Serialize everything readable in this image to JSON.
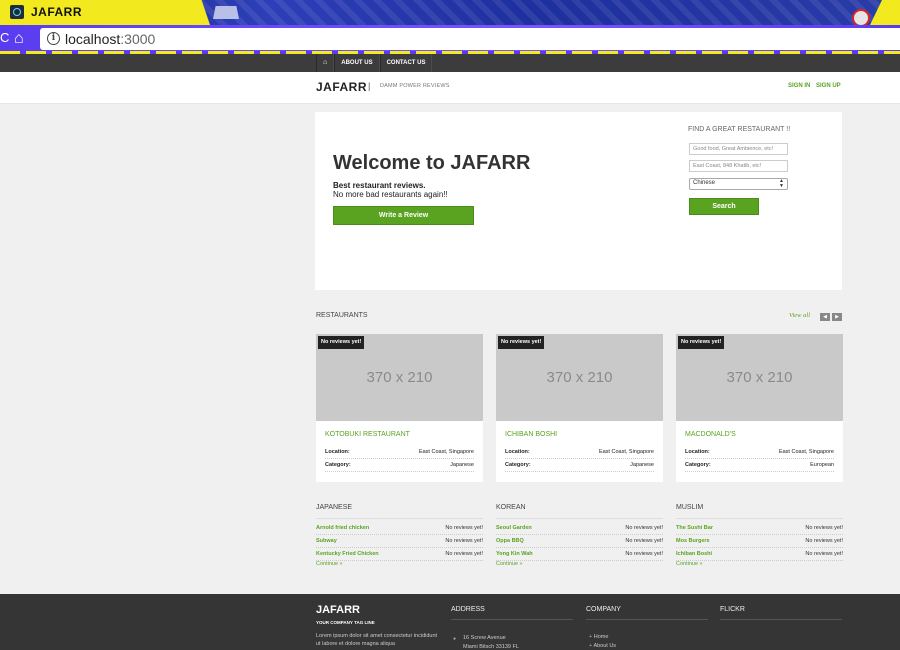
{
  "browser": {
    "tab_title": "JAFARR",
    "url_host": "localhost",
    "url_port": ":3000",
    "nav_partial": "C"
  },
  "topnav": {
    "home_icon": "home-icon",
    "items": [
      "ABOUT US",
      "CONTACT US"
    ]
  },
  "header": {
    "logo": "JAFARR",
    "separator": "|",
    "tagline": "DAMM POWER REVIEWS",
    "sign_in": "SIGN IN",
    "sign_up": "SIGN UP"
  },
  "hero": {
    "title": "Welcome to JAFARR",
    "subtitle_bold": "Best restaurant reviews.",
    "subtitle": "No more bad restaurants again!!",
    "write_button": "Write a Review",
    "find_title": "FIND A GREAT RESTAURANT !!",
    "field1_placeholder": "Good food, Great Ambience, etc!",
    "field2_placeholder": "East Coast, 848 Khatib, etc!",
    "cuisine_selected": "Chinese",
    "search_button": "Search"
  },
  "restaurants": {
    "section_title": "RESTAURANTS",
    "view_all": "View all",
    "prev": "◀",
    "next": "▶",
    "cards": [
      {
        "badge": "No reviews yet!",
        "image_text": "370 x 210",
        "name": "KOTOBUKI RESTAURANT",
        "location_label": "Location:",
        "location": "East Coast, Singapore",
        "category_label": "Category:",
        "category": "Japanese"
      },
      {
        "badge": "No reviews yet!",
        "image_text": "370 x 210",
        "name": "ICHIBAN BOSHI",
        "location_label": "Location:",
        "location": "East Coast, Singapore",
        "category_label": "Category:",
        "category": "Japanese"
      },
      {
        "badge": "No reviews yet!",
        "image_text": "370 x 210",
        "name": "MACDONALD'S",
        "location_label": "Location:",
        "location": "East Coast, Singapore",
        "category_label": "Category:",
        "category": "European"
      }
    ]
  },
  "categories": [
    {
      "title": "JAPANESE",
      "items": [
        {
          "name": "Arnold fried chicken",
          "status": "No reviews yet!"
        },
        {
          "name": "Subway",
          "status": "No reviews yet!"
        },
        {
          "name": "Kentucky Fried Chicken",
          "status": "No reviews yet!"
        }
      ],
      "continue": "Continue »"
    },
    {
      "title": "KOREAN",
      "items": [
        {
          "name": "Seoul Garden",
          "status": "No reviews yet!"
        },
        {
          "name": "Oppa BBQ",
          "status": "No reviews yet!"
        },
        {
          "name": "Yong Kin Wah",
          "status": "No reviews yet!"
        }
      ],
      "continue": "Continue »"
    },
    {
      "title": "MUSLIM",
      "items": [
        {
          "name": "The Sushi Bar",
          "status": "No reviews yet!"
        },
        {
          "name": "Mos Burgers",
          "status": "No reviews yet!"
        },
        {
          "name": "Ichiban Boshi",
          "status": "No reviews yet!"
        }
      ],
      "continue": "Continue »"
    }
  ],
  "footer": {
    "logo": "JAFARR",
    "tagline": "YOUR COMPANY TAG LINE",
    "lorem": "Lorem ipsum dolor sit amet consectetur incididunt ut labore et dolore magna aliqua",
    "address_title": "ADDRESS",
    "address_line1": "16 Screw Avenue",
    "address_line2": "Miami Bitsch 33139 FL",
    "company_title": "COMPANY",
    "company_links": [
      "Home",
      "About Us"
    ],
    "flickr_title": "FLICKR"
  },
  "colors": {
    "accent_green": "#5aa321",
    "topnav_bg": "#3c3c3c",
    "footer_bg": "#353535"
  }
}
